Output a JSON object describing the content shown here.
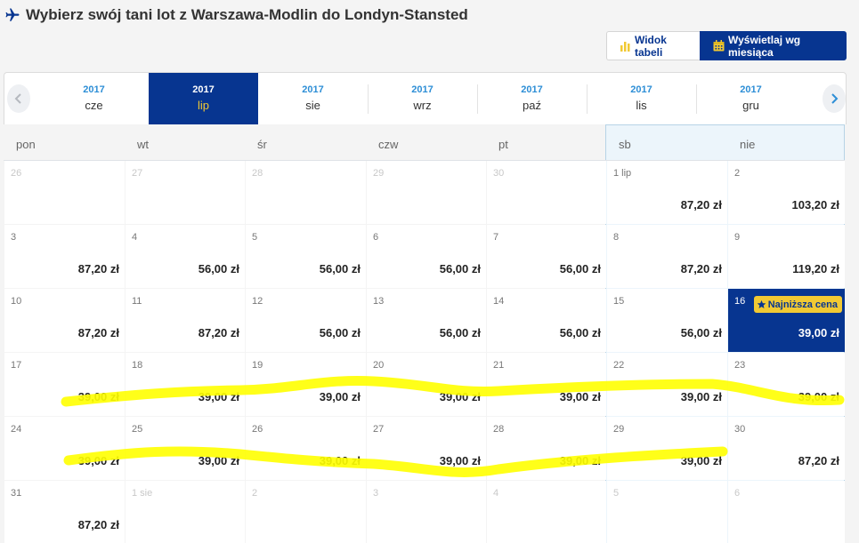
{
  "header": {
    "title": "Wybierz swój tani lot z Warszawa-Modlin do Londyn-Stansted"
  },
  "view_toggle": {
    "table_label": "Widok tabeli",
    "month_label": "Wyświetlaj wg miesiąca"
  },
  "months": [
    {
      "year": "2017",
      "month": "cze"
    },
    {
      "year": "2017",
      "month": "lip",
      "active": true
    },
    {
      "year": "2017",
      "month": "sie"
    },
    {
      "year": "2017",
      "month": "wrz"
    },
    {
      "year": "2017",
      "month": "paź"
    },
    {
      "year": "2017",
      "month": "lis"
    },
    {
      "year": "2017",
      "month": "gru"
    }
  ],
  "weekdays": [
    "pon",
    "wt",
    "śr",
    "czw",
    "pt",
    "sb",
    "nie"
  ],
  "lowest_badge": "Najniższa cena",
  "weeks": [
    [
      {
        "day": "26",
        "empty": true
      },
      {
        "day": "27",
        "empty": true
      },
      {
        "day": "28",
        "empty": true
      },
      {
        "day": "29",
        "empty": true
      },
      {
        "day": "30",
        "empty": true
      },
      {
        "day": "1 lip",
        "price": "87,20 zł"
      },
      {
        "day": "2",
        "price": "103,20 zł"
      }
    ],
    [
      {
        "day": "3",
        "price": "87,20 zł"
      },
      {
        "day": "4",
        "price": "56,00 zł"
      },
      {
        "day": "5",
        "price": "56,00 zł"
      },
      {
        "day": "6",
        "price": "56,00 zł"
      },
      {
        "day": "7",
        "price": "56,00 zł"
      },
      {
        "day": "8",
        "price": "87,20 zł"
      },
      {
        "day": "9",
        "price": "119,20 zł"
      }
    ],
    [
      {
        "day": "10",
        "price": "87,20 zł"
      },
      {
        "day": "11",
        "price": "87,20 zł"
      },
      {
        "day": "12",
        "price": "56,00 zł"
      },
      {
        "day": "13",
        "price": "56,00 zł"
      },
      {
        "day": "14",
        "price": "56,00 zł"
      },
      {
        "day": "15",
        "price": "56,00 zł"
      },
      {
        "day": "16",
        "price": "39,00 zł",
        "lowest": true
      }
    ],
    [
      {
        "day": "17",
        "price": "39,00 zł"
      },
      {
        "day": "18",
        "price": "39,00 zł"
      },
      {
        "day": "19",
        "price": "39,00 zł"
      },
      {
        "day": "20",
        "price": "39,00 zł"
      },
      {
        "day": "21",
        "price": "39,00 zł"
      },
      {
        "day": "22",
        "price": "39,00 zł"
      },
      {
        "day": "23",
        "price": "39,00 zł"
      }
    ],
    [
      {
        "day": "24",
        "price": "39,00 zł"
      },
      {
        "day": "25",
        "price": "39,00 zł"
      },
      {
        "day": "26",
        "price": "39,00 zł"
      },
      {
        "day": "27",
        "price": "39,00 zł"
      },
      {
        "day": "28",
        "price": "39,00 zł"
      },
      {
        "day": "29",
        "price": "39,00 zł"
      },
      {
        "day": "30",
        "price": "87,20 zł"
      }
    ],
    [
      {
        "day": "31",
        "price": "87,20 zł"
      },
      {
        "day": "1 sie",
        "empty": true
      },
      {
        "day": "2",
        "empty": true
      },
      {
        "day": "3",
        "empty": true
      },
      {
        "day": "4",
        "empty": true
      },
      {
        "day": "5",
        "empty": true
      },
      {
        "day": "6",
        "empty": true
      }
    ]
  ],
  "colors": {
    "brand_blue": "#073590",
    "accent_yellow": "#f1c933",
    "year_blue": "#2d8ed6",
    "weekend_bg": "#ecf5fb",
    "marker_highlight": "#ffff00"
  },
  "icons": {
    "title": "plane-icon",
    "table_view": "bar-chart-icon",
    "month_view": "calendar-icon",
    "prev": "chevron-left-icon",
    "next": "chevron-right-icon",
    "badge": "star-icon"
  }
}
